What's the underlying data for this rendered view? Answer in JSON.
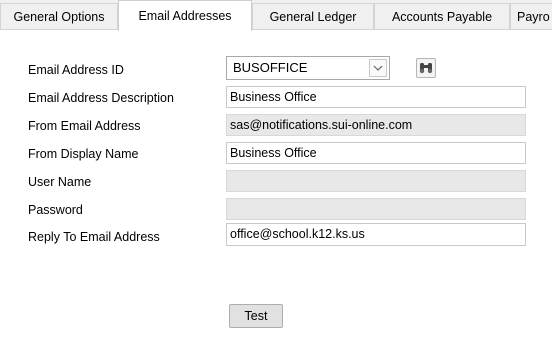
{
  "tabs": [
    {
      "label": "General Options"
    },
    {
      "label": "Email Addresses"
    },
    {
      "label": "General Ledger"
    },
    {
      "label": "Accounts Payable"
    },
    {
      "label": "Payro"
    }
  ],
  "active_tab": "Email Addresses",
  "form": {
    "email_address_id": {
      "label": "Email Address ID",
      "value": "BUSOFFICE"
    },
    "description": {
      "label": "Email Address Description",
      "value": "Business Office"
    },
    "from_email": {
      "label": "From Email Address",
      "value": "sas@notifications.sui-online.com"
    },
    "from_display": {
      "label": "From Display Name",
      "value": "Business Office"
    },
    "user_name": {
      "label": "User Name",
      "value": ""
    },
    "password": {
      "label": "Password",
      "value": ""
    },
    "reply_to": {
      "label": "Reply To Email Address",
      "value": "office@school.k12.ks.us"
    }
  },
  "buttons": {
    "test": "Test"
  },
  "icons": {
    "dropdown": "chevron-down-icon",
    "find": "binoculars-icon"
  },
  "colors": {
    "readonly_bg": "#e8e8e8",
    "panel_bg": "#ffffff",
    "chrome_bg": "#f0f0f0"
  }
}
